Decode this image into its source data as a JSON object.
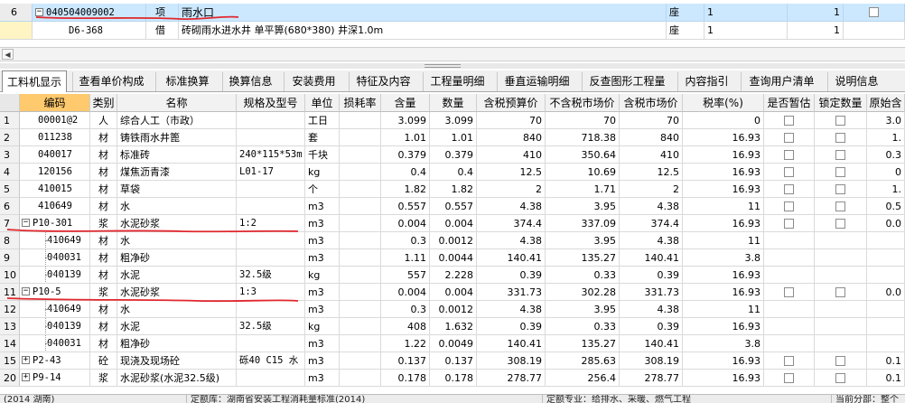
{
  "top_grid": {
    "rows": [
      {
        "rownum": "6",
        "expander": "−",
        "code": "040504009002",
        "category": "项",
        "name": "雨水口",
        "unit": "座",
        "qty": "1",
        "amount": "1",
        "selected": true
      },
      {
        "rownum": "",
        "expander": "",
        "code": "D6-368",
        "category": "借",
        "name": "砖砌雨水进水井 单平箅(680*380) 井深1.0m",
        "unit": "座",
        "qty": "1",
        "amount": "1",
        "selected": false
      }
    ]
  },
  "scrollbar": {
    "left_arrow": "◀"
  },
  "tabs": [
    {
      "label": "工料机显示",
      "active": true
    },
    {
      "label": "查看单价构成",
      "active": false
    },
    {
      "label": "标准换算",
      "active": false
    },
    {
      "label": "换算信息",
      "active": false
    },
    {
      "label": "安装费用",
      "active": false
    },
    {
      "label": "特征及内容",
      "active": false
    },
    {
      "label": "工程量明细",
      "active": false
    },
    {
      "label": "垂直运输明细",
      "active": false
    },
    {
      "label": "反查图形工程量",
      "active": false
    },
    {
      "label": "内容指引",
      "active": false
    },
    {
      "label": "查询用户清单",
      "active": false
    },
    {
      "label": "说明信息",
      "active": false
    }
  ],
  "grid": {
    "headers": [
      "",
      "编码",
      "类别",
      "名称",
      "规格及型号",
      "单位",
      "损耗率",
      "含量",
      "数量",
      "含税预算价",
      "不含税市场价",
      "含税市场价",
      "税率(%)",
      "是否暂估",
      "锁定数量",
      "原始含"
    ],
    "rows": [
      {
        "n": "1",
        "code": "00001@2",
        "cat": "人",
        "name": "综合人工（市政）",
        "spec": "",
        "unit": "工日",
        "loss": "",
        "content": "3.099",
        "qty": "3.099",
        "tax_budget": "70",
        "notax_market": "70",
        "tax_market": "70",
        "rate": "0",
        "est": true,
        "lock": true,
        "orig": "3.0",
        "level": 0,
        "exp": ""
      },
      {
        "n": "2",
        "code": "011238",
        "cat": "材",
        "name": "铸铁雨水井篦",
        "spec": "",
        "unit": "套",
        "loss": "",
        "content": "1.01",
        "qty": "1.01",
        "tax_budget": "840",
        "notax_market": "718.38",
        "tax_market": "840",
        "rate": "16.93",
        "est": true,
        "lock": true,
        "orig": "1.",
        "level": 0,
        "exp": ""
      },
      {
        "n": "3",
        "code": "040017",
        "cat": "材",
        "name": "标准砖",
        "spec": "240*115*53m",
        "unit": "千块",
        "loss": "",
        "content": "0.379",
        "qty": "0.379",
        "tax_budget": "410",
        "notax_market": "350.64",
        "tax_market": "410",
        "rate": "16.93",
        "est": true,
        "lock": true,
        "orig": "0.3",
        "level": 0,
        "exp": ""
      },
      {
        "n": "4",
        "code": "120156",
        "cat": "材",
        "name": "煤焦沥青漆",
        "spec": "L01-17",
        "unit": "kg",
        "loss": "",
        "content": "0.4",
        "qty": "0.4",
        "tax_budget": "12.5",
        "notax_market": "10.69",
        "tax_market": "12.5",
        "rate": "16.93",
        "est": true,
        "lock": true,
        "orig": "0",
        "level": 0,
        "exp": ""
      },
      {
        "n": "5",
        "code": "410015",
        "cat": "材",
        "name": "草袋",
        "spec": "",
        "unit": "个",
        "loss": "",
        "content": "1.82",
        "qty": "1.82",
        "tax_budget": "2",
        "notax_market": "1.71",
        "tax_market": "2",
        "rate": "16.93",
        "est": true,
        "lock": true,
        "orig": "1.",
        "level": 0,
        "exp": ""
      },
      {
        "n": "6",
        "code": "410649",
        "cat": "材",
        "name": "水",
        "spec": "",
        "unit": "m3",
        "loss": "",
        "content": "0.557",
        "qty": "0.557",
        "tax_budget": "4.38",
        "notax_market": "3.95",
        "tax_market": "4.38",
        "rate": "11",
        "est": true,
        "lock": true,
        "orig": "0.5",
        "level": 0,
        "exp": ""
      },
      {
        "n": "7",
        "code": "P10-301",
        "cat": "浆",
        "name": "水泥砂浆",
        "spec": "1:2",
        "unit": "m3",
        "loss": "",
        "content": "0.004",
        "qty": "0.004",
        "tax_budget": "374.4",
        "notax_market": "337.09",
        "tax_market": "374.4",
        "rate": "16.93",
        "est": true,
        "lock": true,
        "orig": "0.0",
        "level": 0,
        "exp": "−"
      },
      {
        "n": "8",
        "code": "410649",
        "cat": "材",
        "name": "水",
        "spec": "",
        "unit": "m3",
        "loss": "",
        "content": "0.3",
        "qty": "0.0012",
        "tax_budget": "4.38",
        "notax_market": "3.95",
        "tax_market": "4.38",
        "rate": "11",
        "est": false,
        "lock": false,
        "orig": "",
        "level": 1,
        "exp": ""
      },
      {
        "n": "9",
        "code": "040031",
        "cat": "材",
        "name": "粗净砂",
        "spec": "",
        "unit": "m3",
        "loss": "",
        "content": "1.11",
        "qty": "0.0044",
        "tax_budget": "140.41",
        "notax_market": "135.27",
        "tax_market": "140.41",
        "rate": "3.8",
        "est": false,
        "lock": false,
        "orig": "",
        "level": 1,
        "exp": ""
      },
      {
        "n": "10",
        "code": "040139",
        "cat": "材",
        "name": "水泥",
        "spec": "32.5级",
        "unit": "kg",
        "loss": "",
        "content": "557",
        "qty": "2.228",
        "tax_budget": "0.39",
        "notax_market": "0.33",
        "tax_market": "0.39",
        "rate": "16.93",
        "est": false,
        "lock": false,
        "orig": "",
        "level": 1,
        "exp": ""
      },
      {
        "n": "11",
        "code": "P10-5",
        "cat": "浆",
        "name": "水泥砂浆",
        "spec": "1:3",
        "unit": "m3",
        "loss": "",
        "content": "0.004",
        "qty": "0.004",
        "tax_budget": "331.73",
        "notax_market": "302.28",
        "tax_market": "331.73",
        "rate": "16.93",
        "est": true,
        "lock": true,
        "orig": "0.0",
        "level": 0,
        "exp": "−"
      },
      {
        "n": "12",
        "code": "410649",
        "cat": "材",
        "name": "水",
        "spec": "",
        "unit": "m3",
        "loss": "",
        "content": "0.3",
        "qty": "0.0012",
        "tax_budget": "4.38",
        "notax_market": "3.95",
        "tax_market": "4.38",
        "rate": "11",
        "est": false,
        "lock": false,
        "orig": "",
        "level": 1,
        "exp": ""
      },
      {
        "n": "13",
        "code": "040139",
        "cat": "材",
        "name": "水泥",
        "spec": "32.5级",
        "unit": "kg",
        "loss": "",
        "content": "408",
        "qty": "1.632",
        "tax_budget": "0.39",
        "notax_market": "0.33",
        "tax_market": "0.39",
        "rate": "16.93",
        "est": false,
        "lock": false,
        "orig": "",
        "level": 1,
        "exp": ""
      },
      {
        "n": "14",
        "code": "040031",
        "cat": "材",
        "name": "粗净砂",
        "spec": "",
        "unit": "m3",
        "loss": "",
        "content": "1.22",
        "qty": "0.0049",
        "tax_budget": "140.41",
        "notax_market": "135.27",
        "tax_market": "140.41",
        "rate": "3.8",
        "est": false,
        "lock": false,
        "orig": "",
        "level": 1,
        "exp": ""
      },
      {
        "n": "15",
        "code": "P2-43",
        "cat": "砼",
        "name": "现浇及现场砼",
        "spec": "砾40 C15 水",
        "unit": "m3",
        "loss": "",
        "content": "0.137",
        "qty": "0.137",
        "tax_budget": "308.19",
        "notax_market": "285.63",
        "tax_market": "308.19",
        "rate": "16.93",
        "est": true,
        "lock": true,
        "orig": "0.1",
        "level": 0,
        "exp": "+"
      },
      {
        "n": "20",
        "code": "P9-14",
        "cat": "浆",
        "name": "水泥砂浆(水泥32.5级)",
        "spec": "",
        "unit": "m3",
        "loss": "",
        "content": "0.178",
        "qty": "0.178",
        "tax_budget": "278.77",
        "notax_market": "256.4",
        "tax_market": "278.77",
        "rate": "16.93",
        "est": true,
        "lock": true,
        "orig": "0.1",
        "level": 0,
        "exp": "+"
      }
    ]
  },
  "status_bar": {
    "s1": "(2014 湖南)",
    "s2": "定额库：湖南省安装工程消耗量标准(2014)",
    "s3": "定额专业：给排水、采暖、燃气工程",
    "s4": "当前分部：整个"
  }
}
